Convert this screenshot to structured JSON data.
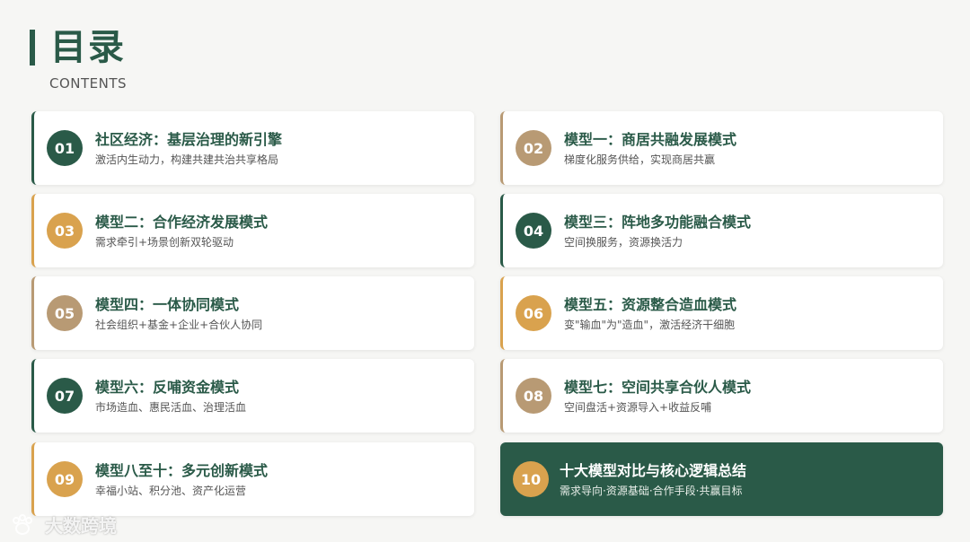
{
  "header": {
    "title": "目录",
    "subtitle": "CONTENTS"
  },
  "colors": {
    "primary": "#2a5a48",
    "gold": "#d9a24e",
    "tan": "#b89a74",
    "background": "#f6f6f4"
  },
  "items": [
    {
      "num": "01",
      "title": "社区经济：基层治理的新引擎",
      "desc": "激活内生动力，构建共建共治共享格局",
      "color": "#2a5a48",
      "accent": "#2a5a48"
    },
    {
      "num": "02",
      "title": "模型一：商居共融发展模式",
      "desc": "梯度化服务供给，实现商居共赢",
      "color": "#b89a74",
      "accent": "#b89a74"
    },
    {
      "num": "03",
      "title": "模型二：合作经济发展模式",
      "desc": "需求牵引+场景创新双轮驱动",
      "color": "#d9a24e",
      "accent": "#d9a24e"
    },
    {
      "num": "04",
      "title": "模型三：阵地多功能融合模式",
      "desc": "空间换服务，资源换活力",
      "color": "#2a5a48",
      "accent": "#2a5a48"
    },
    {
      "num": "05",
      "title": "模型四：一体协同模式",
      "desc": "社会组织+基金+企业+合伙人协同",
      "color": "#b89a74",
      "accent": "#b89a74"
    },
    {
      "num": "06",
      "title": "模型五：资源整合造血模式",
      "desc": "变\"输血\"为\"造血\"，激活经济干细胞",
      "color": "#d9a24e",
      "accent": "#d9a24e"
    },
    {
      "num": "07",
      "title": "模型六：反哺资金模式",
      "desc": "市场造血、惠民活血、治理活血",
      "color": "#2a5a48",
      "accent": "#2a5a48"
    },
    {
      "num": "08",
      "title": "模型七：空间共享合伙人模式",
      "desc": "空间盘活+资源导入+收益反哺",
      "color": "#b89a74",
      "accent": "#b89a74"
    },
    {
      "num": "09",
      "title": "模型八至十：多元创新模式",
      "desc": "幸福小站、积分池、资产化运营",
      "color": "#d9a24e",
      "accent": "#d9a24e"
    },
    {
      "num": "10",
      "title": "十大模型对比与核心逻辑总结",
      "desc": "需求导向·资源基础·合作手段·共赢目标",
      "color": "#d9a24e",
      "accent": "#2a5a48"
    }
  ],
  "watermark": {
    "text": "大数跨境",
    "icon": "paw-logo-icon"
  }
}
